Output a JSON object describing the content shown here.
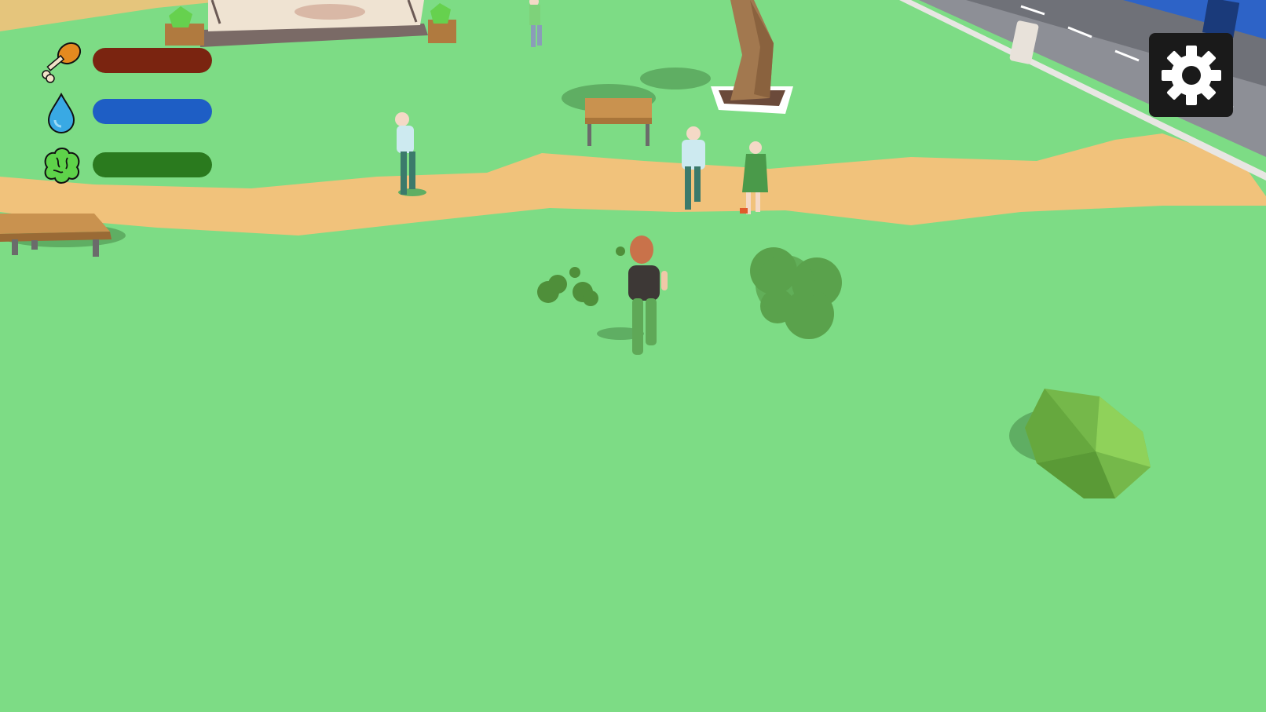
{
  "hud": {
    "stats": [
      {
        "id": "hunger",
        "icon": "drumstick-icon",
        "level": 1.0,
        "color": "#7a2410"
      },
      {
        "id": "thirst",
        "icon": "water-drop-icon",
        "level": 1.0,
        "color": "#1e5ec5"
      },
      {
        "id": "mind",
        "icon": "brain-icon",
        "level": 1.0,
        "color": "#2a7a1e"
      }
    ]
  },
  "settings": {
    "icon": "gear-icon"
  },
  "colors": {
    "grass": "#7ddc85",
    "path": "#f1c27b",
    "wood": "#c9924f",
    "settings_bg": "#1a1a1a"
  }
}
